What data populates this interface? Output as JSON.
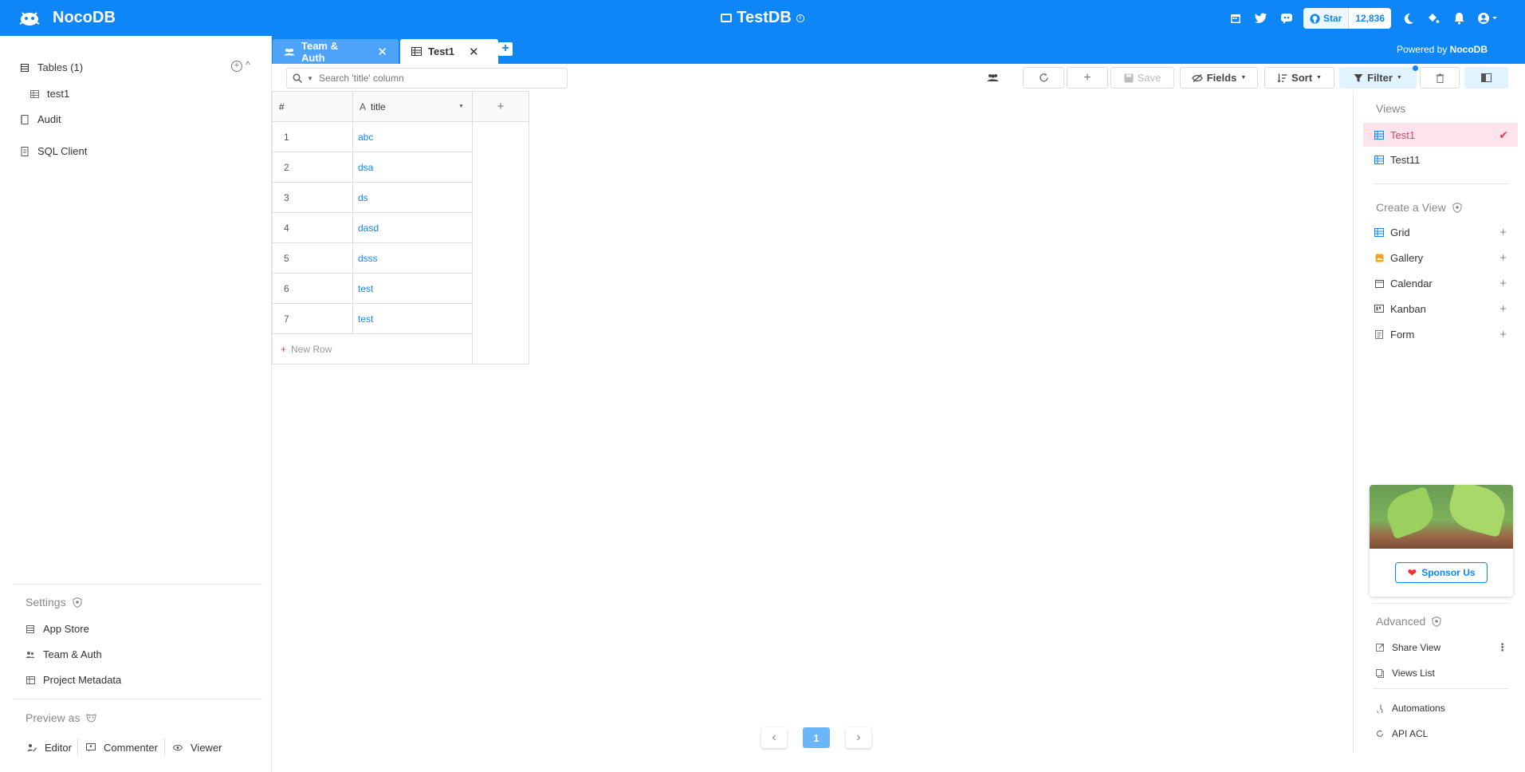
{
  "header": {
    "logo_text": "NocoDB",
    "project_title": "TestDB",
    "github_star_label": "Star",
    "github_star_count": "12,836"
  },
  "tabs": [
    {
      "label": "Team & Auth"
    },
    {
      "label": "Test1"
    }
  ],
  "powered_by": {
    "prefix": "Powered by ",
    "brand": "NocoDB"
  },
  "sidebar": {
    "tables_label": "Tables (1)",
    "table_item": "test1",
    "audit": "Audit",
    "sql_client": "SQL Client",
    "settings_label": "Settings",
    "settings_items": [
      "App Store",
      "Team & Auth",
      "Project Metadata"
    ],
    "preview_label": "Preview as",
    "preview_roles": [
      "Editor",
      "Commenter",
      "Viewer"
    ]
  },
  "toolbar": {
    "search_placeholder": "Search 'title' column",
    "save": "Save",
    "fields": "Fields",
    "sort": "Sort",
    "filter": "Filter"
  },
  "grid": {
    "index_header": "#",
    "column_header": "title",
    "rows": [
      "abc",
      "dsa",
      "ds",
      "dasd",
      "dsss",
      "test",
      "test"
    ],
    "new_row": "New Row"
  },
  "pagination": {
    "current_page": "1"
  },
  "views_panel": {
    "views_label": "Views",
    "views": [
      "Test1",
      "Test11"
    ],
    "create_label": "Create a View",
    "create_types": [
      "Grid",
      "Gallery",
      "Calendar",
      "Kanban",
      "Form"
    ],
    "sponsor_label": "Sponsor Us",
    "advanced_label": "Advanced",
    "advanced_items": [
      "Share View",
      "Views List",
      "Automations",
      "API ACL"
    ]
  },
  "colors": {
    "primary": "#0f86f5",
    "accent": "#e13e6a"
  }
}
